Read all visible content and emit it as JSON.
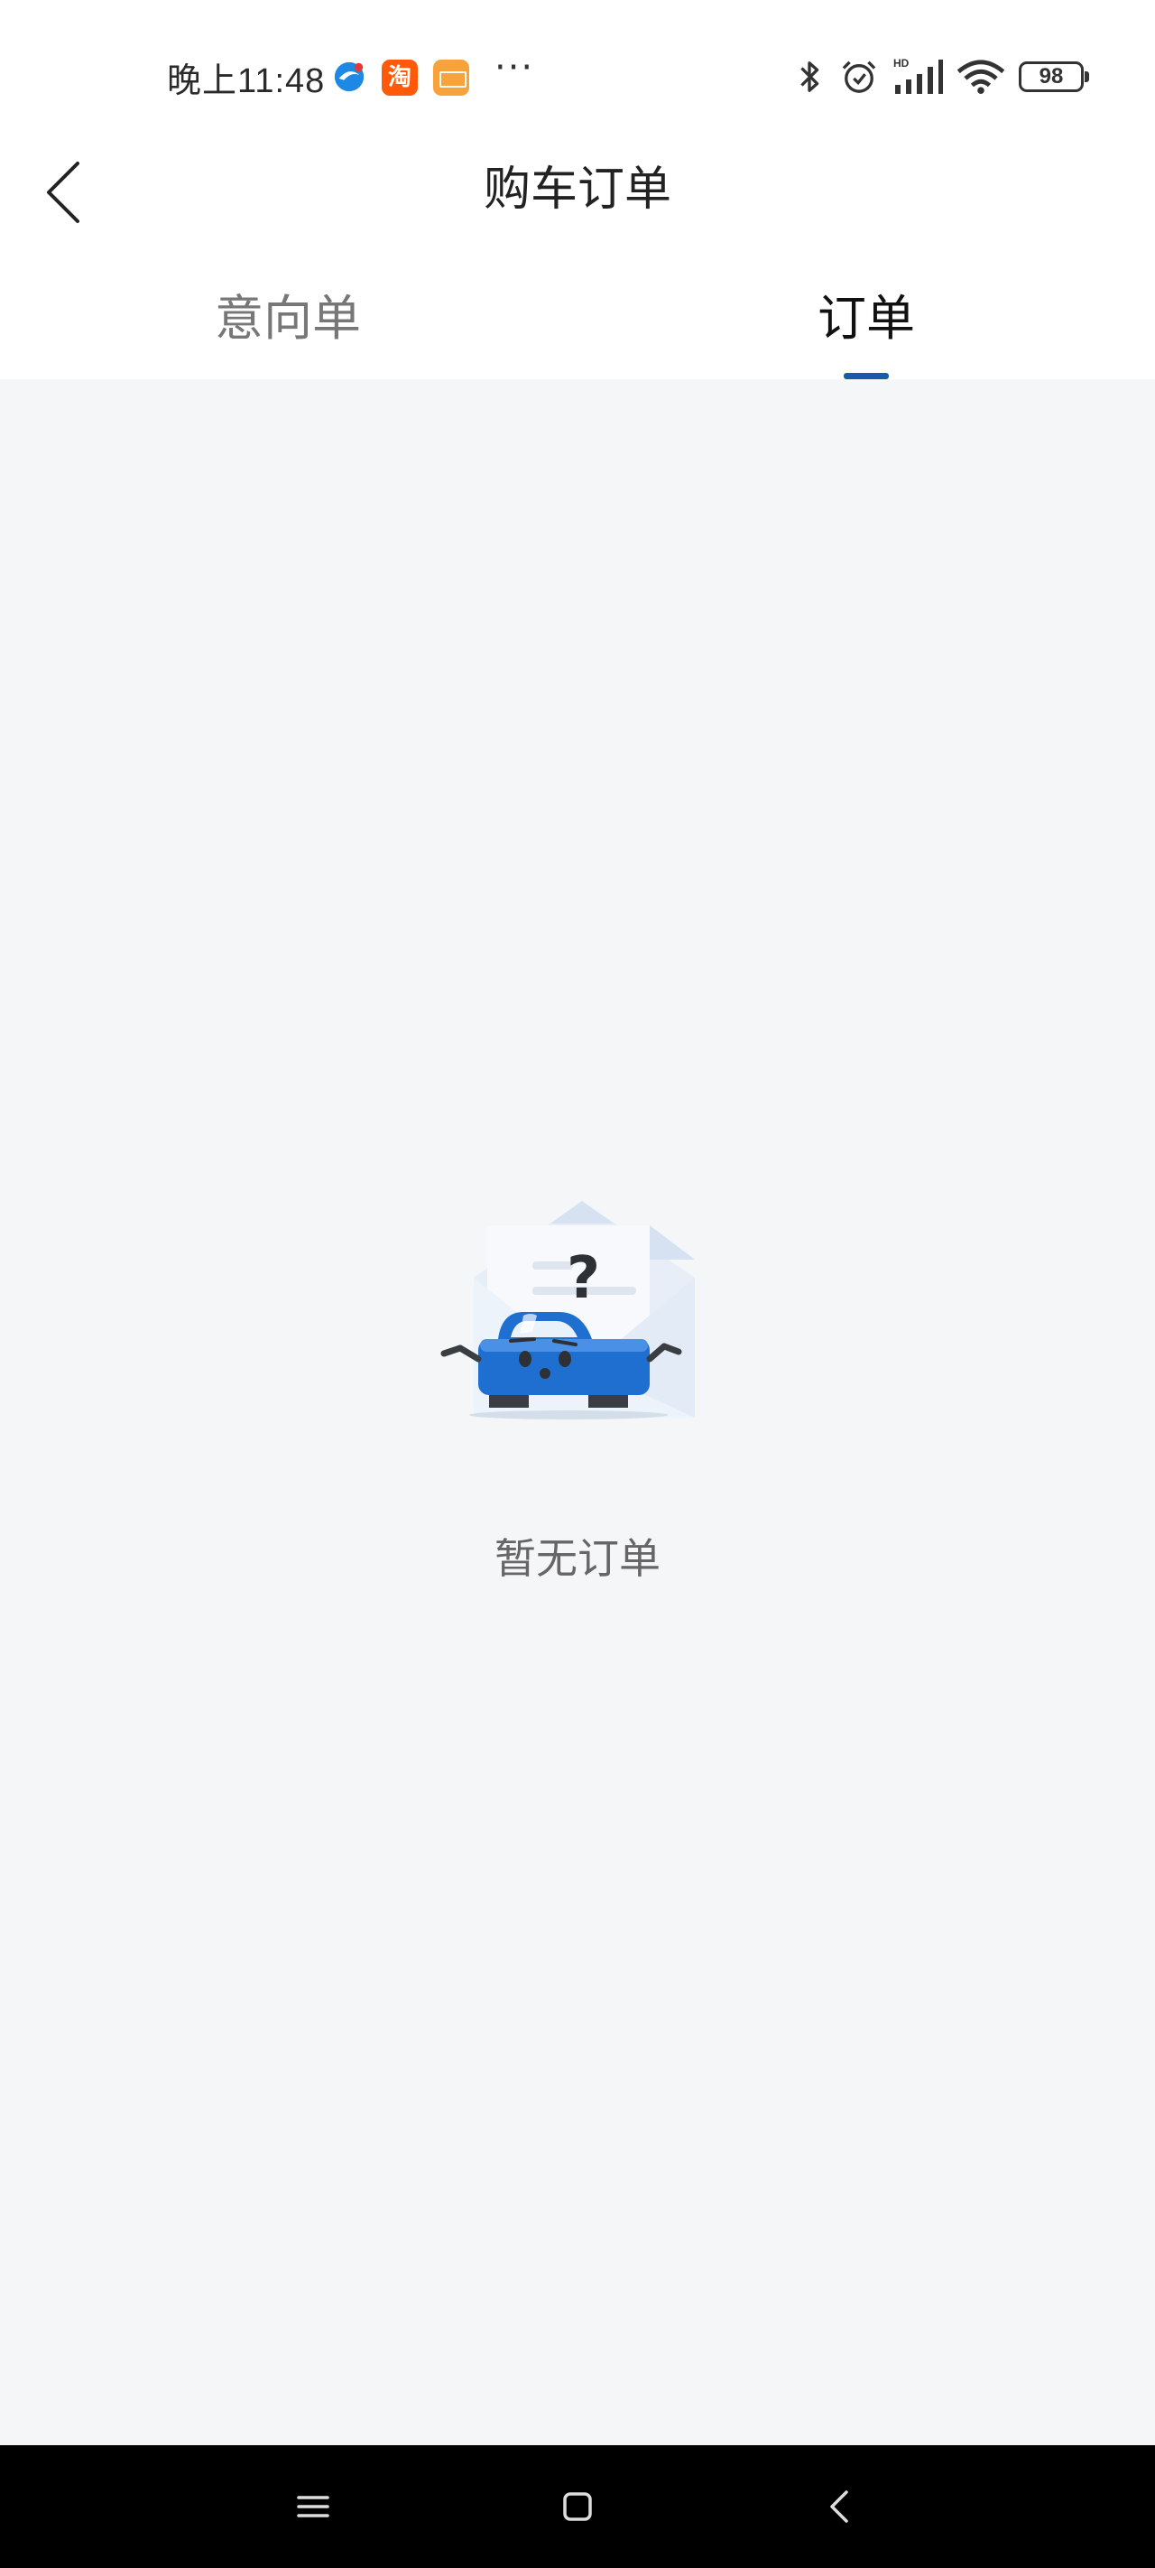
{
  "status_bar": {
    "time": "晚上11:48",
    "app_icons": [
      "browser-icon",
      "taobao-icon",
      "card-app-icon"
    ],
    "taobao_glyph": "淘",
    "more": "···",
    "battery": "98"
  },
  "header": {
    "title": "购车订单",
    "back_icon": "chevron-left-icon"
  },
  "tabs": [
    {
      "label": "意向单",
      "active": false
    },
    {
      "label": "订单",
      "active": true
    }
  ],
  "empty_state": {
    "message": "暂无订单",
    "illustration": "confused-car-envelope"
  },
  "nav_bar": {
    "icons": [
      "menu-icon",
      "home-icon",
      "back-icon"
    ]
  },
  "colors": {
    "accent": "#1a5aa8",
    "background": "#f5f6f8",
    "car_blue": "#1f6fd1"
  }
}
